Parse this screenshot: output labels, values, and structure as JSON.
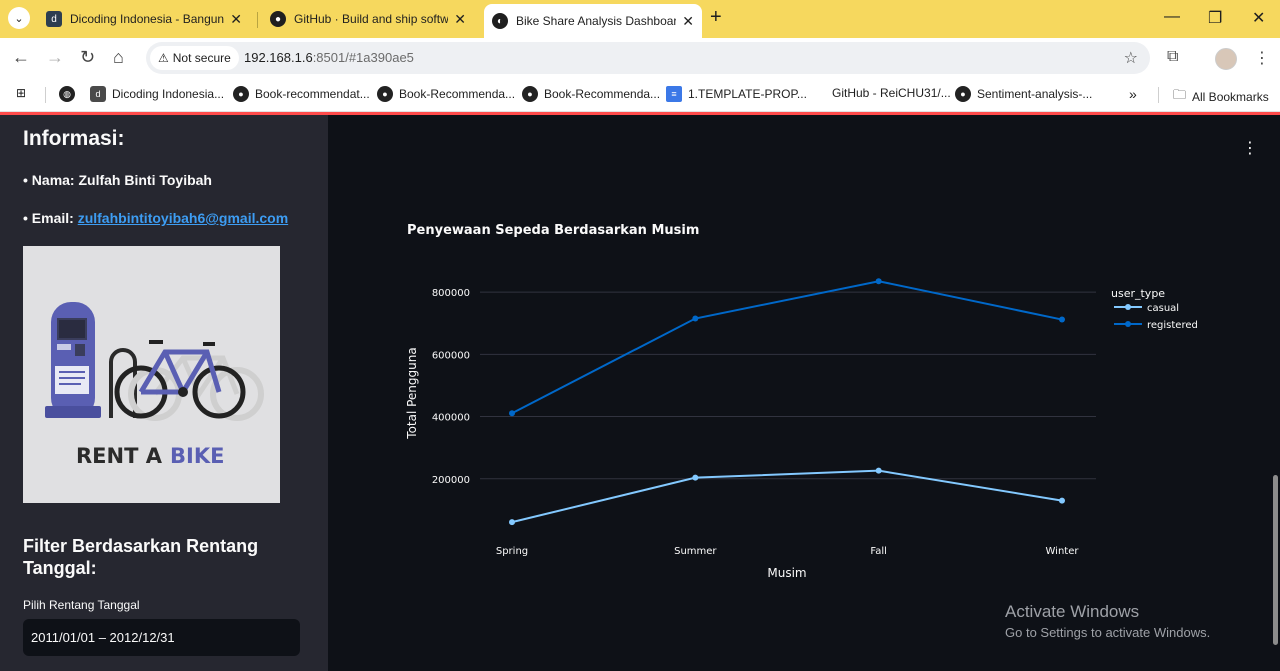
{
  "browser": {
    "tabs": [
      {
        "title": "Dicoding Indonesia - Bangun K",
        "favicon": "dicoding-icon"
      },
      {
        "title": "GitHub · Build and ship softwar",
        "favicon": "github-icon"
      },
      {
        "title": "Bike Share Analysis Dashboard",
        "favicon": "streamlit-icon",
        "active": true
      }
    ],
    "security_label": "Not secure",
    "url_host": "192.168.1.6",
    "url_rest": ":8501/#1a390ae5",
    "bookmarks": [
      {
        "label": "Dicoding Indonesia...",
        "icon": "dicoding-icon"
      },
      {
        "label": "Book-recommendat...",
        "icon": "github-icon"
      },
      {
        "label": "Book-Recommenda...",
        "icon": "github-icon"
      },
      {
        "label": "Book-Recommenda...",
        "icon": "github-icon"
      },
      {
        "label": "1.TEMPLATE-PROP...",
        "icon": "doc-icon"
      },
      {
        "label": "GitHub - ReiCHU31/...",
        "icon": "none"
      },
      {
        "label": "Sentiment-analysis-...",
        "icon": "github-icon"
      }
    ],
    "all_bookmarks": "All Bookmarks"
  },
  "sidebar": {
    "title": "Informasi:",
    "name_line": "• Nama: Zulfah Binti Toyibah",
    "email_prefix": "• Email: ",
    "email": "zulfahbintitoyibah6@gmail.com",
    "image_caption_rent": "RENT A",
    "image_caption_bike": "BIKE",
    "filter_title": "Filter Berdasarkan Rentang Tanggal:",
    "date_label": "Pilih Rentang Tanggal",
    "date_value": "2011/01/01 – 2012/12/31"
  },
  "windows_notice": {
    "line1": "Activate Windows",
    "line2": "Go to Settings to activate Windows."
  },
  "colors": {
    "casual": "#83c9ff",
    "registered": "#0068c9",
    "accent": "#ff4b4b"
  },
  "chart_data": {
    "type": "line",
    "title": "Penyewaan Sepeda Berdasarkan Musim",
    "xlabel": "Musim",
    "ylabel": "Total Pengguna",
    "categories": [
      "Spring",
      "Summer",
      "Fall",
      "Winter"
    ],
    "yticks": [
      200000,
      400000,
      600000,
      800000
    ],
    "ytick_labels": [
      "200000",
      "400000",
      "600000",
      "800000"
    ],
    "ylim": [
      0,
      900000
    ],
    "grid": true,
    "legend_title": "user_type",
    "legend_position": "top-right",
    "series": [
      {
        "name": "casual",
        "values": [
          60622,
          203522,
          226091,
          129782
        ]
      },
      {
        "name": "registered",
        "values": [
          410726,
          715067,
          835038,
          711831
        ]
      }
    ]
  }
}
